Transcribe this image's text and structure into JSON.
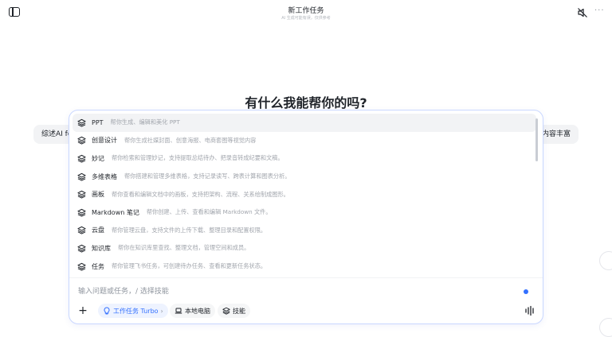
{
  "header": {
    "title": "新工作任务",
    "subtitle": "AI 生成可能有误，仅供参考"
  },
  "main": {
    "heading": "有什么我能帮你的吗?",
    "suggestion_left": "综述AI fo",
    "suggestion_right": "内容丰富"
  },
  "skills": [
    {
      "name": "PPT",
      "desc": "帮你生成、编辑和美化 PPT"
    },
    {
      "name": "创意设计",
      "desc": "帮你生成社媒封面、创意海报、电商套图等视觉内容"
    },
    {
      "name": "妙记",
      "desc": "帮你检索和管理妙记，支持提取总结待办、把录音转成纪要和文稿。"
    },
    {
      "name": "多维表格",
      "desc": "帮你搭建和管理多维表格，支持记录读写、跨表计算和图表分析。"
    },
    {
      "name": "画板",
      "desc": "帮你查看和编辑文档中的画板，支持把架构、流程、关系绘制成图形。"
    },
    {
      "name": "Markdown 笔记",
      "desc": "帮你创建、上传、查看和编辑 Markdown 文件。"
    },
    {
      "name": "云盘",
      "desc": "帮你管理云盘，支持文件的上传下载、整理目录和配置权限。"
    },
    {
      "name": "知识库",
      "desc": "帮你在知识库里查找、整理文档，管理空间和成员。"
    },
    {
      "name": "任务",
      "desc": "帮你管理飞书任务，可创建待办任务、查看和更新任务状态。"
    }
  ],
  "composer": {
    "placeholder": "输入问题或任务，/ 选择技能",
    "mode_label": "工作任务 Turbo",
    "computer_label": "本地电脑",
    "skills_label": "技能"
  },
  "colors": {
    "accent": "#3370ff",
    "panel_border": "#c9d7ff",
    "muted_text": "#a2a6ad"
  }
}
